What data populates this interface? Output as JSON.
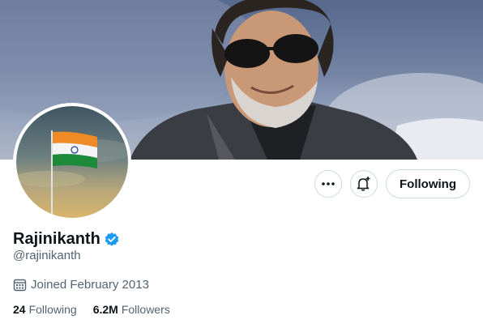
{
  "profile": {
    "display_name": "Rajinikanth",
    "handle": "@rajinikanth",
    "verified": true,
    "joined": "Joined February 2013"
  },
  "actions": {
    "more_icon": "more-horizontal-icon",
    "notify_icon": "bell-plus-icon",
    "follow_label": "Following"
  },
  "stats": {
    "following_count": "24",
    "following_label": "Following",
    "followers_count": "6.2M",
    "followers_label": "Followers"
  },
  "colors": {
    "verified_badge": "#1d9bf0",
    "secondary_text": "#536471",
    "border": "#cfd9de"
  }
}
